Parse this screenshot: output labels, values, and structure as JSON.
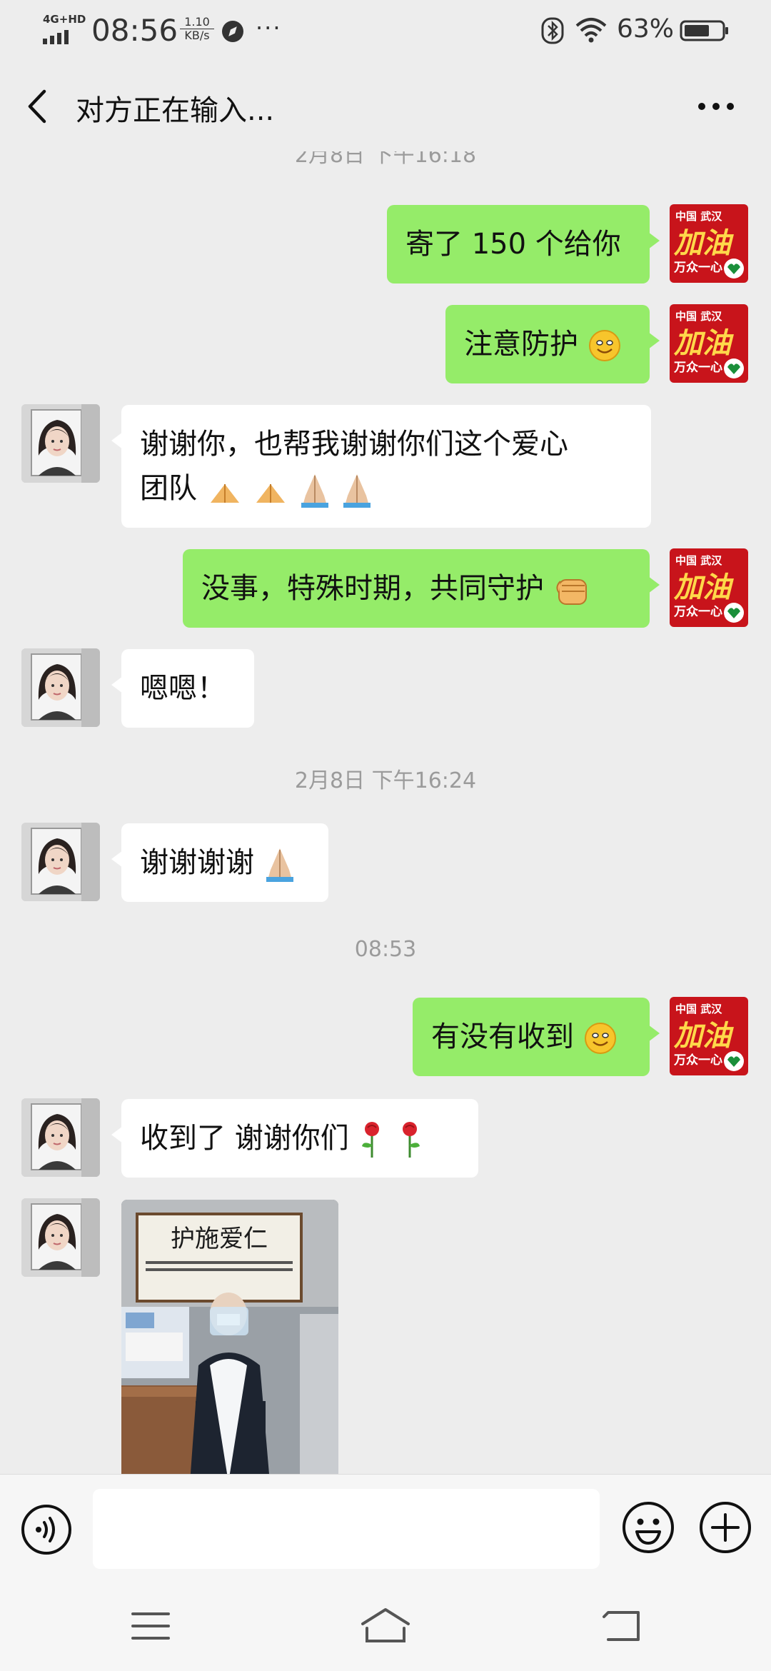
{
  "status_bar": {
    "network": "4G+HD",
    "time": "08:56",
    "speed_rate": "1.10",
    "speed_unit": "KB/s",
    "more": "···",
    "battery_percent": "63%"
  },
  "header": {
    "title": "对方正在输入..."
  },
  "timestamps": [
    "2月8日 下午16:18",
    "2月8日 下午16:24",
    "08:53"
  ],
  "messages": [
    {
      "from": "me",
      "text": "寄了 150 个给你"
    },
    {
      "from": "me",
      "text": "注意防护"
    },
    {
      "from": "them",
      "line1": "谢谢你，也帮我谢谢你们这个爱心",
      "line2": "团队"
    },
    {
      "from": "me",
      "text": "没事，特殊时期，共同守护"
    },
    {
      "from": "them",
      "text": "嗯嗯！"
    },
    {
      "from": "them",
      "text": "谢谢谢谢"
    },
    {
      "from": "me",
      "text": "有没有收到"
    },
    {
      "from": "them",
      "text": "收到了 谢谢你们"
    }
  ],
  "avatar_badge": {
    "top": "中国 武汉",
    "main": "加油",
    "bottom": "万众一心"
  },
  "photo_text": {
    "plaque": "护施爱仁"
  },
  "colors": {
    "my_bubble": "#95ec69",
    "their_bubble": "#ffffff",
    "background": "#ededed",
    "badge_red": "#c8141b"
  }
}
